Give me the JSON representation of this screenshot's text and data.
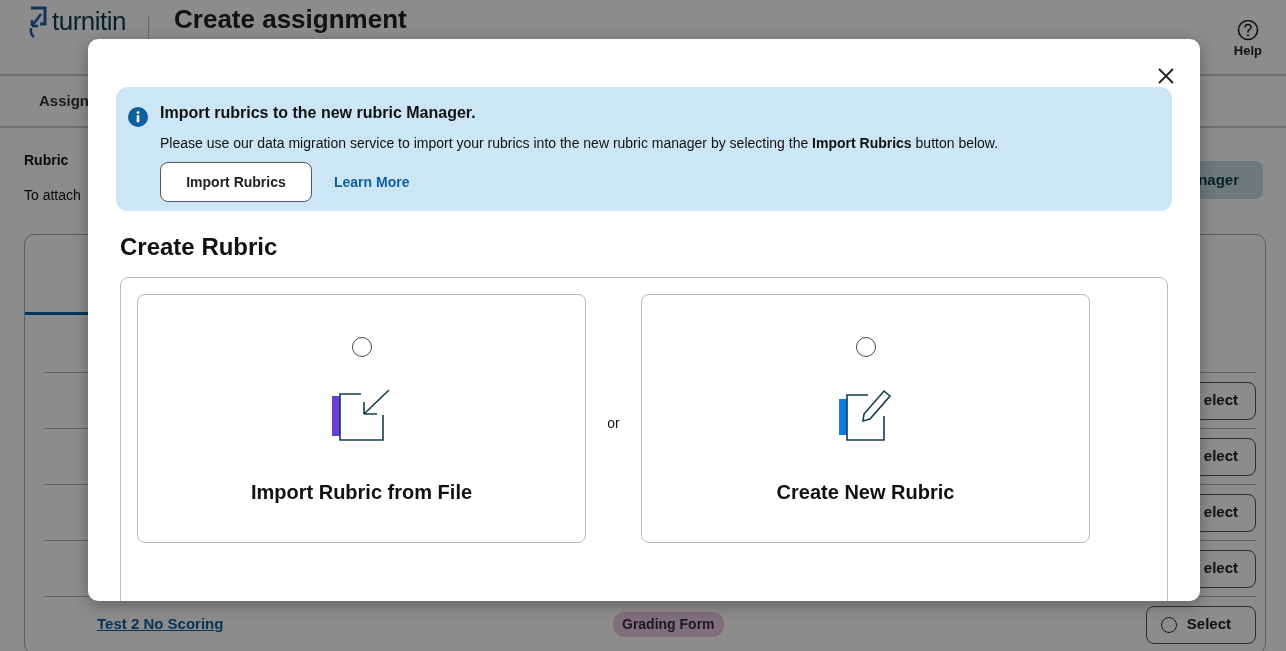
{
  "header": {
    "logo": "turnitin",
    "title": "Create assignment",
    "help": "Help"
  },
  "nav": {
    "tab": "Assign"
  },
  "rubric_section": {
    "label": "Rubric",
    "description": "To attach",
    "button": "nager"
  },
  "rubric_list": {
    "rows": [
      {
        "action": "elect"
      },
      {
        "action": "elect"
      },
      {
        "action": "elect"
      },
      {
        "action": "elect"
      },
      {
        "name": "Test 2 No Scoring",
        "type": "Grading Form",
        "action": "Select",
        "selected": false
      }
    ]
  },
  "modal": {
    "alert": {
      "title": "Import rubrics to the new rubric Manager.",
      "message": "Please use our data migration service to import your rubrics into the new rubric manager by selecting the **Import Rubrics** button below.",
      "buttons": [
        {
          "label": "Import Rubrics",
          "kind": "outline"
        },
        {
          "label": "Learn More",
          "kind": "link"
        }
      ]
    },
    "heading": "Create Rubric",
    "options": [
      {
        "kind": "import",
        "label": "Import Rubric from File",
        "selected": false
      },
      {
        "kind": "create",
        "label": "Create New Rubric",
        "selected": false
      }
    ],
    "separator": "or"
  }
}
